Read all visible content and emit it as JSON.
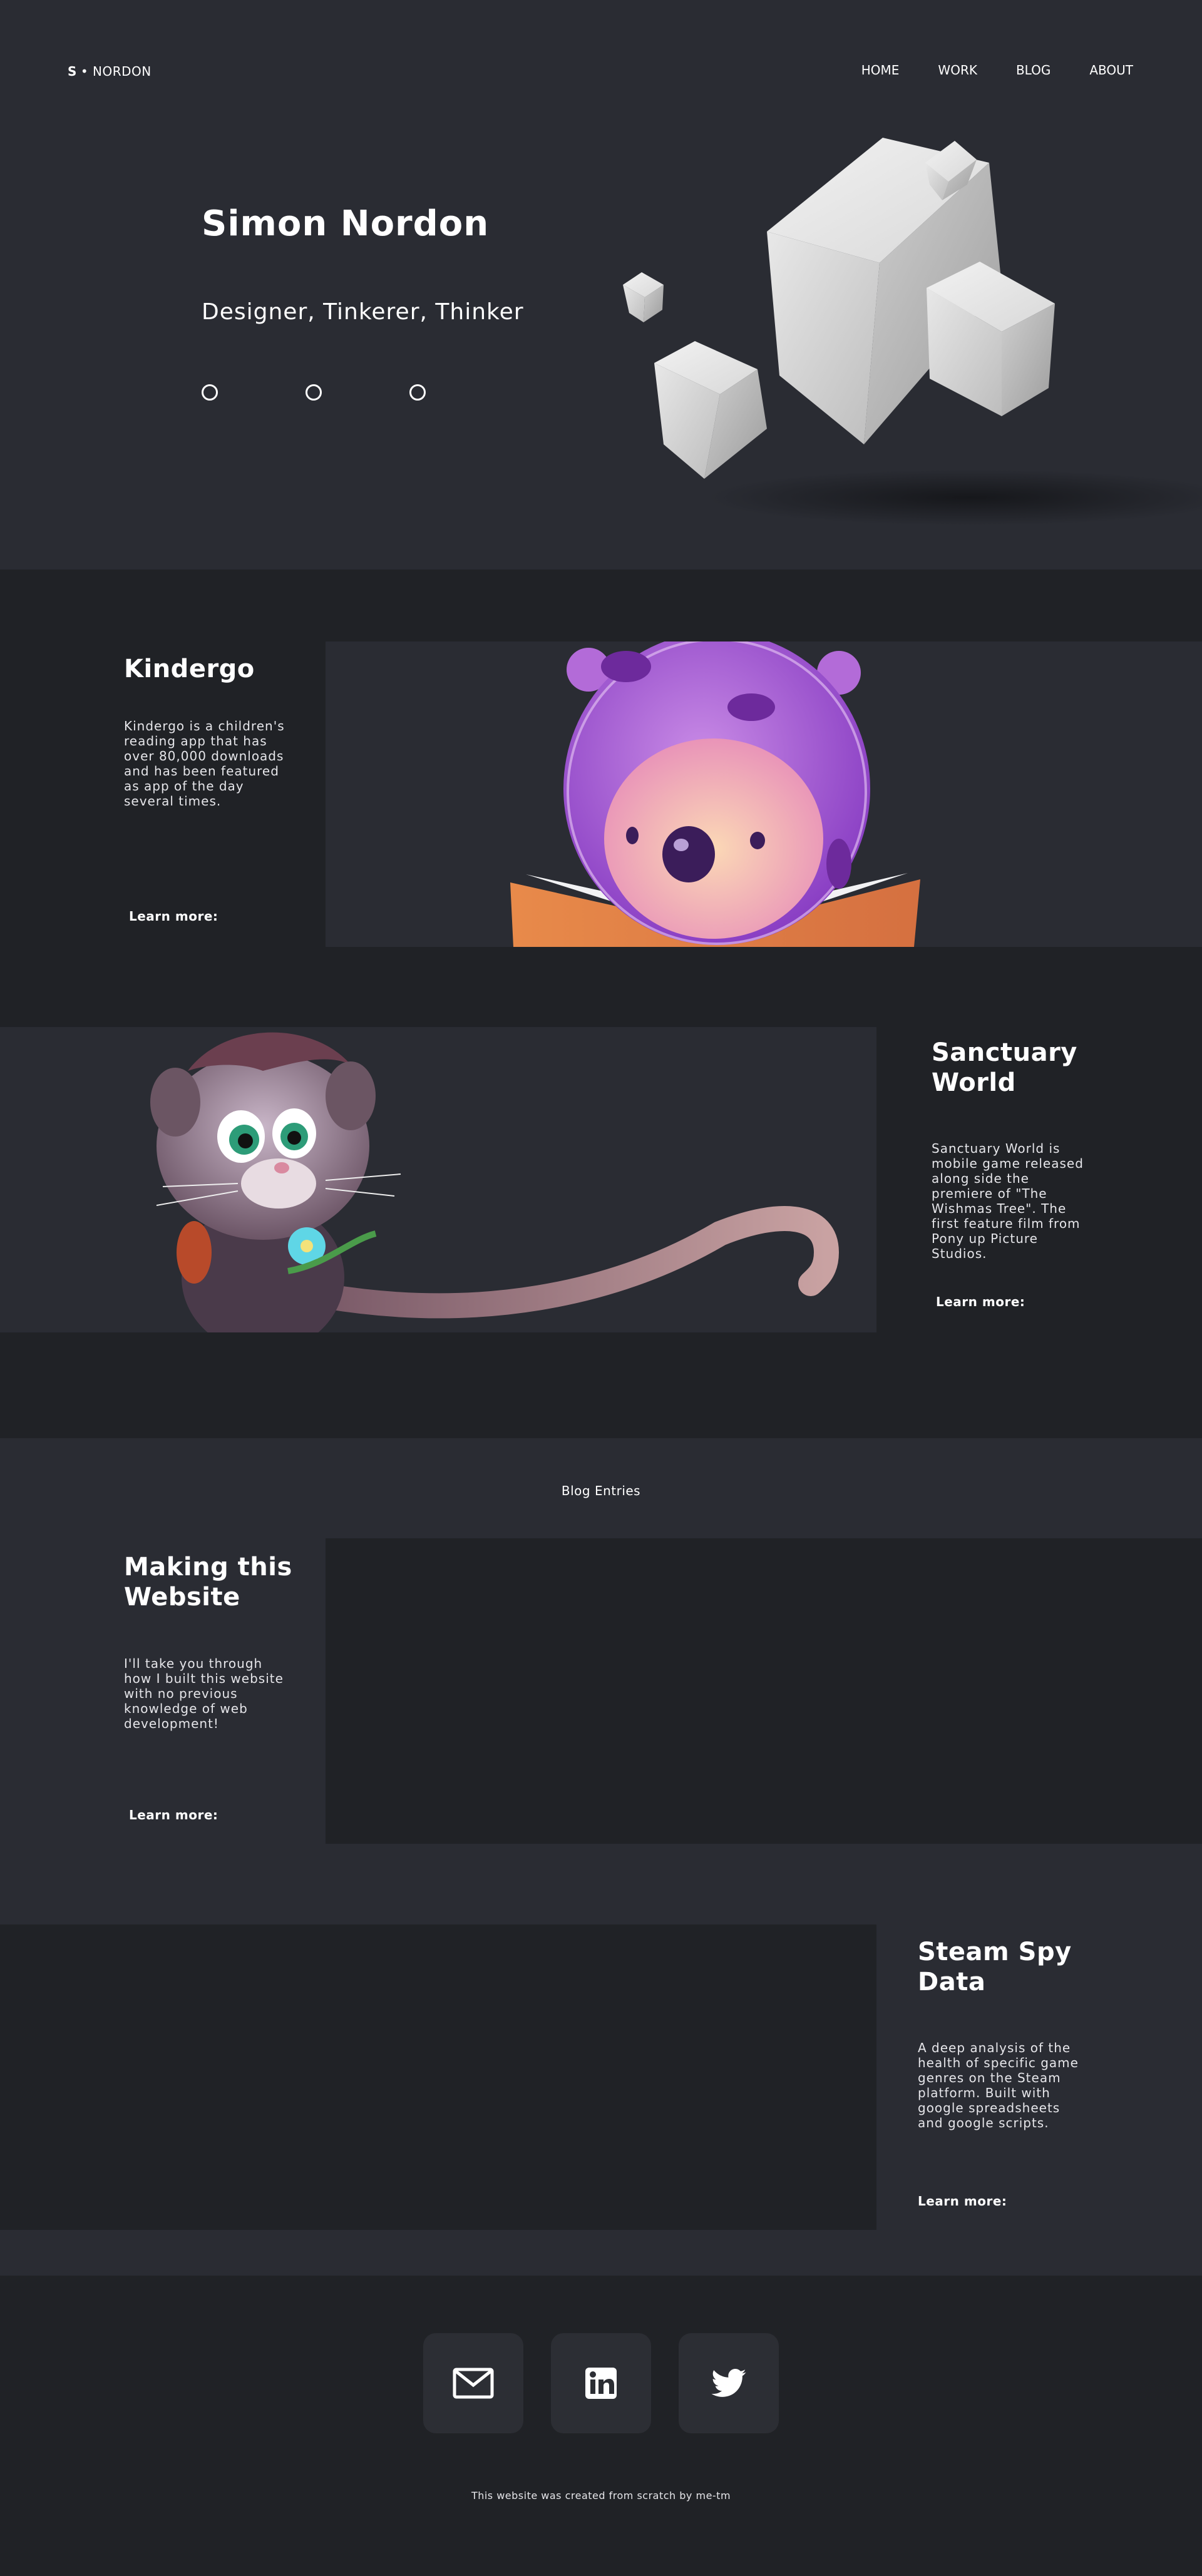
{
  "header": {
    "logo_mark": "S",
    "logo_text": "• NORDON",
    "nav": [
      {
        "label": "HOME"
      },
      {
        "label": "WORK"
      },
      {
        "label": "BLOG"
      },
      {
        "label": "ABOUT"
      }
    ]
  },
  "hero": {
    "title": "Simon Nordon",
    "subtitle": "Designer, Tinkerer, Thinker"
  },
  "projects": [
    {
      "title": "Kindergo",
      "description": "Kindergo is a children's reading app that has over 80,000 downloads and has been featured as app of the day several times.",
      "learn_more": "Learn more:"
    },
    {
      "title": "Sanctuary World",
      "description": "Sanctuary World is mobile game released along side the premiere of \"The Wishmas Tree\". The first feature film from Pony up Picture Studios.",
      "learn_more": "Learn more:"
    }
  ],
  "blog": {
    "section_label": "Blog Entries",
    "entries": [
      {
        "title": "Making this Website",
        "description": "I'll take you through how I built this website with no previous knowledge of web development!",
        "learn_more": "Learn more:"
      },
      {
        "title": "Steam Spy Data",
        "description": "A deep analysis of the health of specific game genres on the Steam platform. Built with google spreadsheets and google scripts.",
        "learn_more": "Learn more:"
      }
    ]
  },
  "footer": {
    "social": [
      {
        "icon": "mail-icon"
      },
      {
        "icon": "linkedin-icon"
      },
      {
        "icon": "twitter-icon"
      }
    ],
    "note": "This website was created from scratch by me-tm"
  },
  "colors": {
    "background_light": "#2a2c33",
    "background_dark": "#202226",
    "text": "#ffffff"
  }
}
